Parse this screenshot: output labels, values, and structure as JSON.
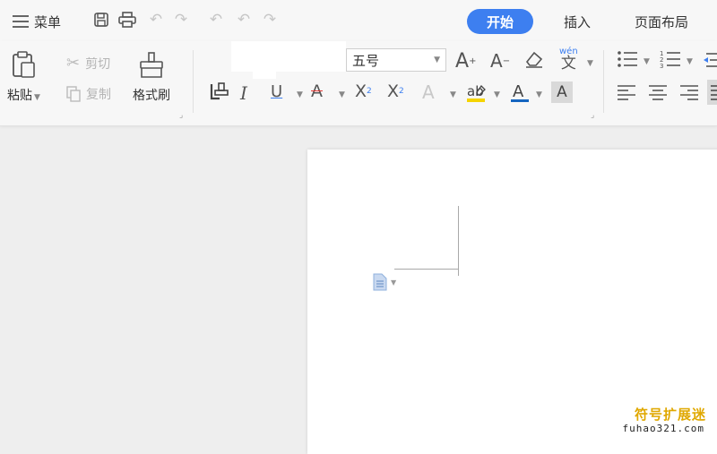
{
  "menu": {
    "label": "菜单"
  },
  "tabs": [
    {
      "label": "开始",
      "active": true
    },
    {
      "label": "插入",
      "active": false
    },
    {
      "label": "页面布局",
      "active": false
    }
  ],
  "clipboard": {
    "paste_label": "粘贴",
    "cut_label": "剪切",
    "copy_label": "复制",
    "format_painter_label": "格式刷"
  },
  "font": {
    "size_value": "五号",
    "phonetic_label": "wén",
    "phonetic_char": "文"
  },
  "colors": {
    "accent": "#3d7ff0",
    "highlight": "#f5d400",
    "font_color": "#1565c0",
    "watermark": "#e0a800"
  },
  "watermark": {
    "zh": "符号扩展迷",
    "en": "fuhao321.com"
  }
}
